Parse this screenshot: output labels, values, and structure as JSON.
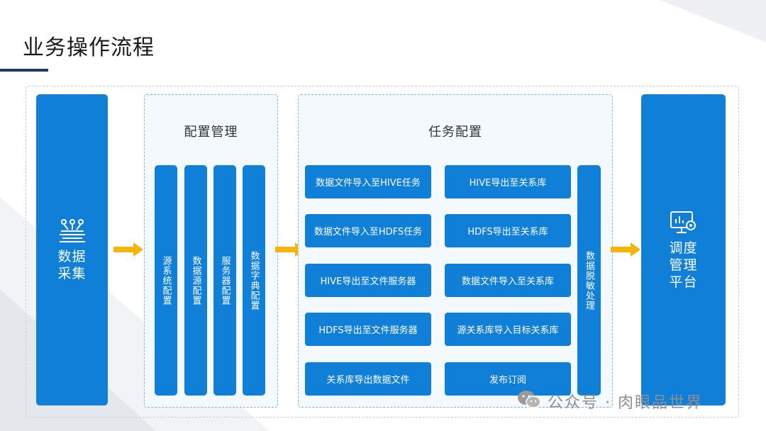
{
  "slide": {
    "title": "业务操作流程"
  },
  "diagram": {
    "data_collection": {
      "label": "数据\n采集",
      "icon": "data-collect-icon"
    },
    "config_mgmt": {
      "title": "配置管理",
      "items": [
        "源系统配置",
        "数据源配置",
        "服务器配置",
        "数据字典配置"
      ]
    },
    "task_config": {
      "title": "任务配置",
      "left_tasks": [
        "数据文件导入至HIVE任务",
        "数据文件导入至HDFS任务",
        "HIVE导出至文件服务器",
        "HDFS导出至文件服务器",
        "关系库导出数据文件"
      ],
      "right_tasks": [
        "HIVE导出至关系库",
        "HDFS导出至关系库",
        "数据文件导入至关系库",
        "源关系库导入目标关系库",
        "发布订阅"
      ],
      "side": "数据脱敏处理"
    },
    "scheduler": {
      "label": "调度\n管理\n平台",
      "icon": "monitor-gear-icon"
    }
  },
  "watermark": {
    "text": "公众号 · 肉眼品世界",
    "icon": "wechat-icon"
  },
  "colors": {
    "primary": "#0f7fd8",
    "arrow": "#f5b40a",
    "title_bar": "#1f3a78"
  }
}
